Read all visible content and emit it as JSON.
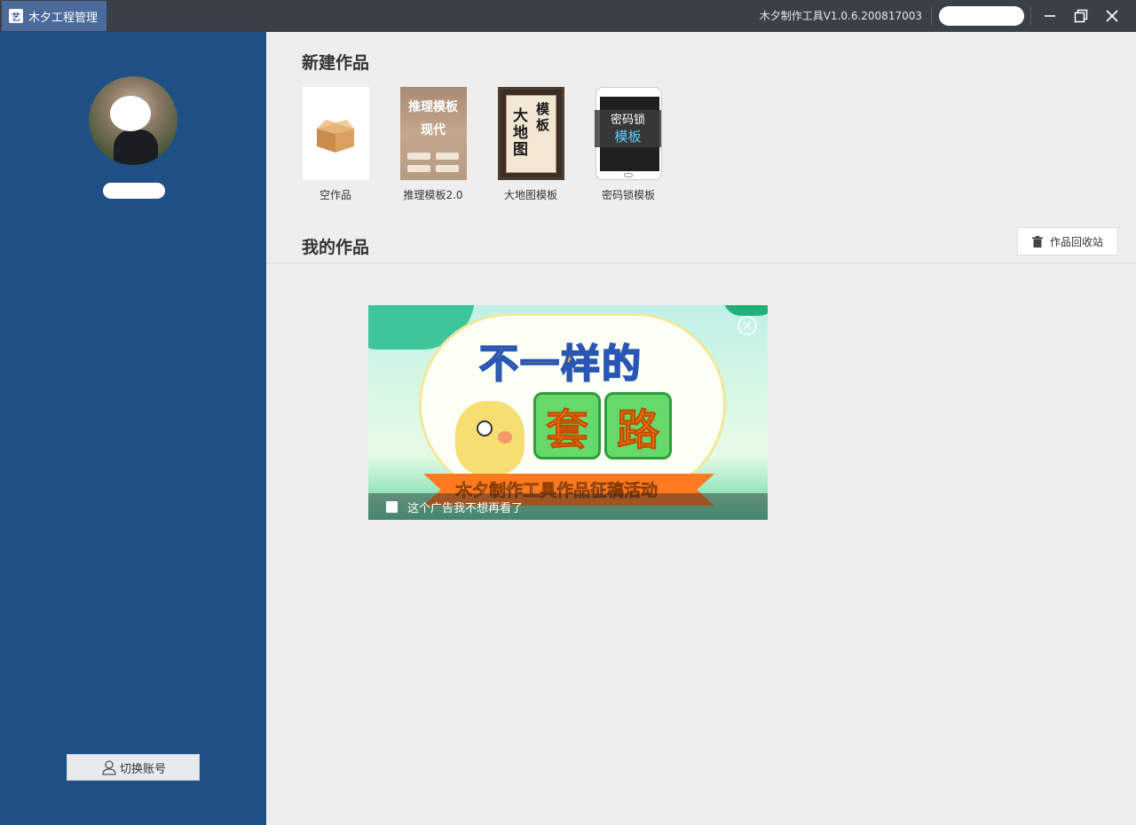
{
  "titlebar": {
    "app_name": "木夕工程管理",
    "logo_glyph": "艺",
    "version": "木夕制作工具V1.0.6.200817003"
  },
  "sidebar": {
    "switch_account_label": "切换账号"
  },
  "new_works": {
    "title": "新建作品",
    "templates": [
      {
        "label": "空作品"
      },
      {
        "label": "推理模板2.0",
        "thumb_line1": "推理模板",
        "thumb_line2": "现代"
      },
      {
        "label": "大地图模板",
        "thumb_big": "大地图",
        "thumb_small": "模板"
      },
      {
        "label": "密码锁模板",
        "overlay_line1": "密码锁",
        "overlay_line2": "模板"
      }
    ]
  },
  "my_works": {
    "title": "我的作品",
    "recycle_label": "作品回收站"
  },
  "ad": {
    "headline": "不一样的",
    "tile1": "套",
    "tile2": "路",
    "ribbon": "木夕制作工具作品征稿活动",
    "dismiss_label": "这个广告我不想再看了"
  },
  "colors": {
    "titlebar": "#3b3f48",
    "app_tab": "#4b6a9c",
    "sidebar": "#1f5085",
    "background": "#eeeeee",
    "lock_accent": "#59d0ff"
  }
}
